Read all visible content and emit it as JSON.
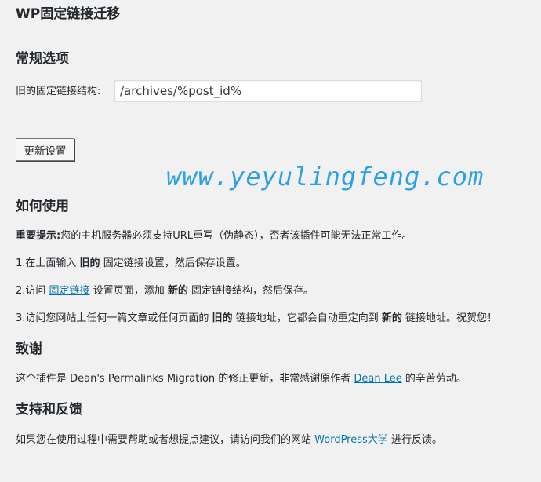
{
  "page_title": "WP固定链接迁移",
  "general": {
    "heading": "常规选项",
    "old_structure_label": "旧的固定链接结构:",
    "old_structure_value": "/archives/%post_id%",
    "save_button": "更新设置"
  },
  "watermark": "www.yeyulingfeng.com",
  "howto": {
    "heading": "如何使用",
    "notice_bold": "重要提示:",
    "notice_text": "您的主机服务器必须支持URL重写（伪静态），否者该插件可能无法正常工作。",
    "step1_a": "1.在上面输入",
    "step1_bold": "旧的",
    "step1_b": "固定链接设置，然后保存设置。",
    "step2_a": "2.访问",
    "step2_link": "固定链接",
    "step2_b": "设置页面，添加",
    "step2_bold": "新的",
    "step2_c": "固定链接结构，然后保存。",
    "step3_a": "3.访问您网站上任何一篇文章或任何页面的",
    "step3_bold1": "旧的",
    "step3_b": "链接地址，它都会自动重定向到",
    "step3_bold2": "新的",
    "step3_c": "链接地址。祝贺您！"
  },
  "thanks": {
    "heading": "致谢",
    "text_a": "这个插件是 Dean's Permalinks Migration 的修正更新，非常感谢原作者",
    "author_link": "Dean Lee",
    "text_b": "的辛苦劳动。"
  },
  "support": {
    "heading": "支持和反馈",
    "text_a": "如果您在使用过程中需要帮助或者想提点建议，请访问我们的网站",
    "site_link": "WordPress大学",
    "text_b": "进行反馈。"
  }
}
